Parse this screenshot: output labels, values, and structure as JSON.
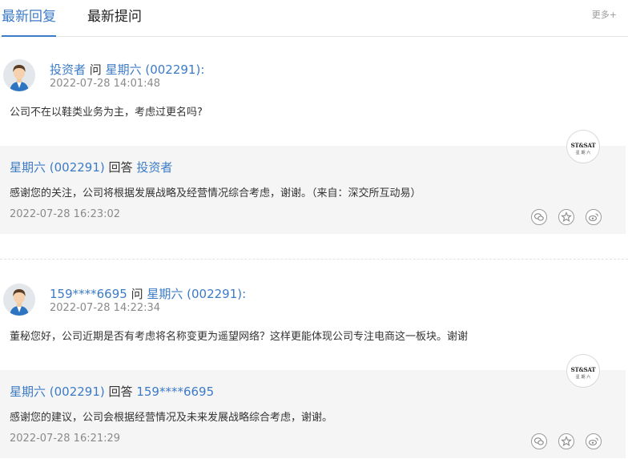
{
  "tabs": [
    {
      "label": "最新回复",
      "active": true
    },
    {
      "label": "最新提问",
      "active": false
    }
  ],
  "more_label": "更多+",
  "accent_color": "#3c7bc6",
  "seal": {
    "text": "ST&SAT",
    "sub": "星 期 六"
  },
  "items": [
    {
      "asker": "投资者",
      "ask_word": "问",
      "company": "星期六 (002291):",
      "question_time": "2022-07-28 14:01:48",
      "question": "公司不在以鞋类业务为主，考虑过更名吗?",
      "answer_company": "星期六 (002291)",
      "answer_word": "回答",
      "answer_to": "投资者",
      "answer": "感谢您的关注，公司将根据发展战略及经营情况综合考虑，谢谢。（来自：深交所互动易）",
      "answer_time": "2022-07-28 16:23:02"
    },
    {
      "asker": "159****6695",
      "ask_word": "问",
      "company": "星期六 (002291):",
      "question_time": "2022-07-28 14:22:34",
      "question": "董秘您好，公司近期是否有考虑将名称变更为遥望网络？这样更能体现公司专注电商这一板块。谢谢",
      "answer_company": "星期六 (002291)",
      "answer_word": "回答",
      "answer_to": "159****6695",
      "answer": "感谢您的建议，公司会根据经营情况及未来发展战略综合考虑，谢谢。",
      "answer_time": "2022-07-28 16:21:29"
    }
  ],
  "action_icons": [
    "wechat-icon",
    "star-icon",
    "weibo-icon"
  ]
}
